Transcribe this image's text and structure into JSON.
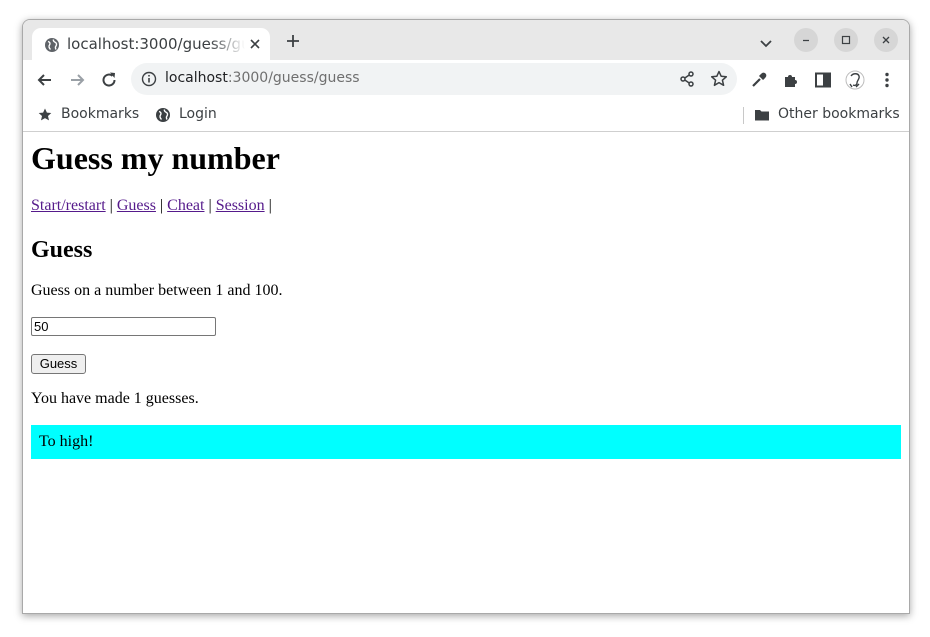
{
  "browser": {
    "tab": {
      "title": "localhost:3000/guess/guess",
      "icon": "globe-icon"
    },
    "url": {
      "host": "localhost",
      "path": ":3000/guess/guess"
    },
    "bookmarks": [
      {
        "label": "Bookmarks",
        "icon": "star-icon"
      },
      {
        "label": "Login",
        "icon": "globe-icon"
      }
    ],
    "other_bookmarks": {
      "label": "Other bookmarks",
      "icon": "folder-icon"
    }
  },
  "page": {
    "title": "Guess my number",
    "nav": {
      "links": [
        "Start/restart",
        "Guess",
        "Cheat",
        "Session"
      ],
      "separator": "|"
    },
    "heading": "Guess",
    "instruction": "Guess on a number between 1 and 100.",
    "input": {
      "value": "50"
    },
    "button_label": "Guess",
    "guess_count_text": "You have made 1 guesses.",
    "feedback": {
      "text": "To high!",
      "background": "#00ffff"
    }
  },
  "colors": {
    "link_visited": "#551a8b",
    "tabstrip": "#e8e8e8",
    "omnibox": "#f1f3f4"
  }
}
